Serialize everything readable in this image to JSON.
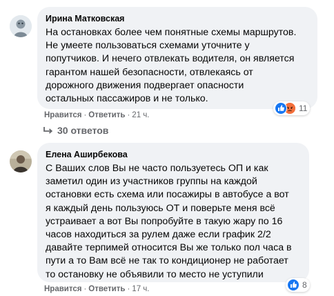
{
  "comments": [
    {
      "author": "Ирина Матковская",
      "lines": [
        "На остановках более чем понятные схемы маршрутов.",
        "Не умеете пользоваться схемами уточните у",
        "попутчиков. И нечего отвлекать водителя, он является",
        "гарантом нашей безопасности, отвлекаясь от",
        "дорожного движения подвергает опасности",
        "остальных пассажиров и не только."
      ],
      "like_label": "Нравится",
      "reply_label": "Ответить",
      "time": "21 ч.",
      "reaction_count": "11",
      "reactions": [
        "like",
        "angry"
      ],
      "replies_label": "30 ответов"
    },
    {
      "author": "Елена Аширбекова",
      "lines": [
        "С Ваших слов Вы не часто пользуетесь ОП и как",
        "заметил один из участников группы на каждой",
        "остановки есть схема или посажиры в автобусе а вот",
        "я каждый день пользуюсь ОТ и поверьте меня всё",
        "устраивает а вот Вы попробуйте в такую жару по 16",
        "часов находиться за рулем даже если график 2/2",
        "давайте терпимей относится Вы же только пол часа в",
        "пути а то Вам всё не так то кондиционер не работает",
        "то остановку не объявили то место не уступили"
      ],
      "like_label": "Нравится",
      "reply_label": "Ответить",
      "time": "17 ч.",
      "reaction_count": "8",
      "reactions": [
        "like"
      ]
    }
  ],
  "colors": {
    "bubble": "#f0f2f5",
    "meta_text": "#65676b",
    "like_blue": "#1877f2",
    "angry_orange": "#f36f3b"
  }
}
